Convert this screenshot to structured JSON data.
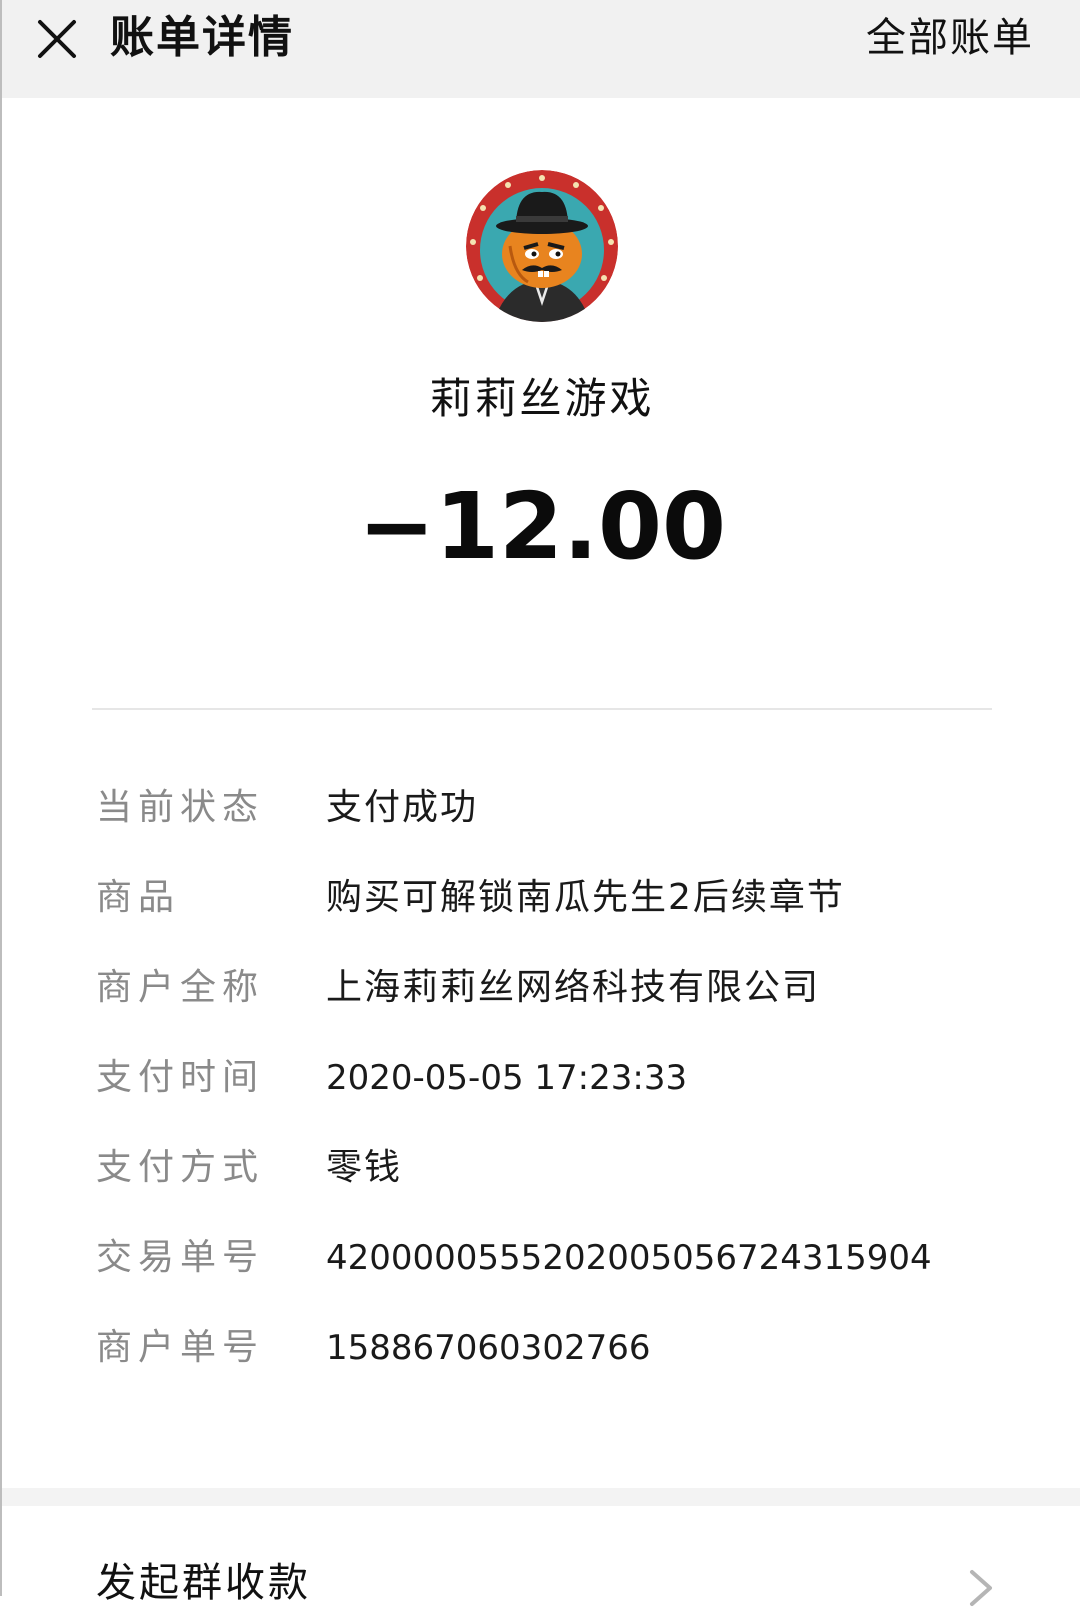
{
  "header": {
    "title": "账单详情",
    "all_bills": "全部账单",
    "close_icon": "close-icon"
  },
  "merchant": {
    "avatar_icon": "merchant-avatar",
    "name": "莉莉丝游戏",
    "amount": "−12.00"
  },
  "details": [
    {
      "label": "当前状态",
      "value": "支付成功"
    },
    {
      "label": "商品",
      "value": "购买可解锁南瓜先生2后续章节"
    },
    {
      "label": "商户全称",
      "value": "上海莉莉丝网络科技有限公司"
    },
    {
      "label": "支付时间",
      "value": "2020-05-05 17:23:33"
    },
    {
      "label": "支付方式",
      "value": "零钱"
    },
    {
      "label": "交易单号",
      "value": "4200000555202005056724315904"
    },
    {
      "label": "商户单号",
      "value": "158867060302766"
    }
  ],
  "footer": {
    "group_collect": "发起群收款",
    "chevron_icon": "chevron-right-icon"
  },
  "colors": {
    "header_bg": "#f1f1f1",
    "label_gray": "#8a8a8a",
    "divider": "#e6e6e6"
  }
}
